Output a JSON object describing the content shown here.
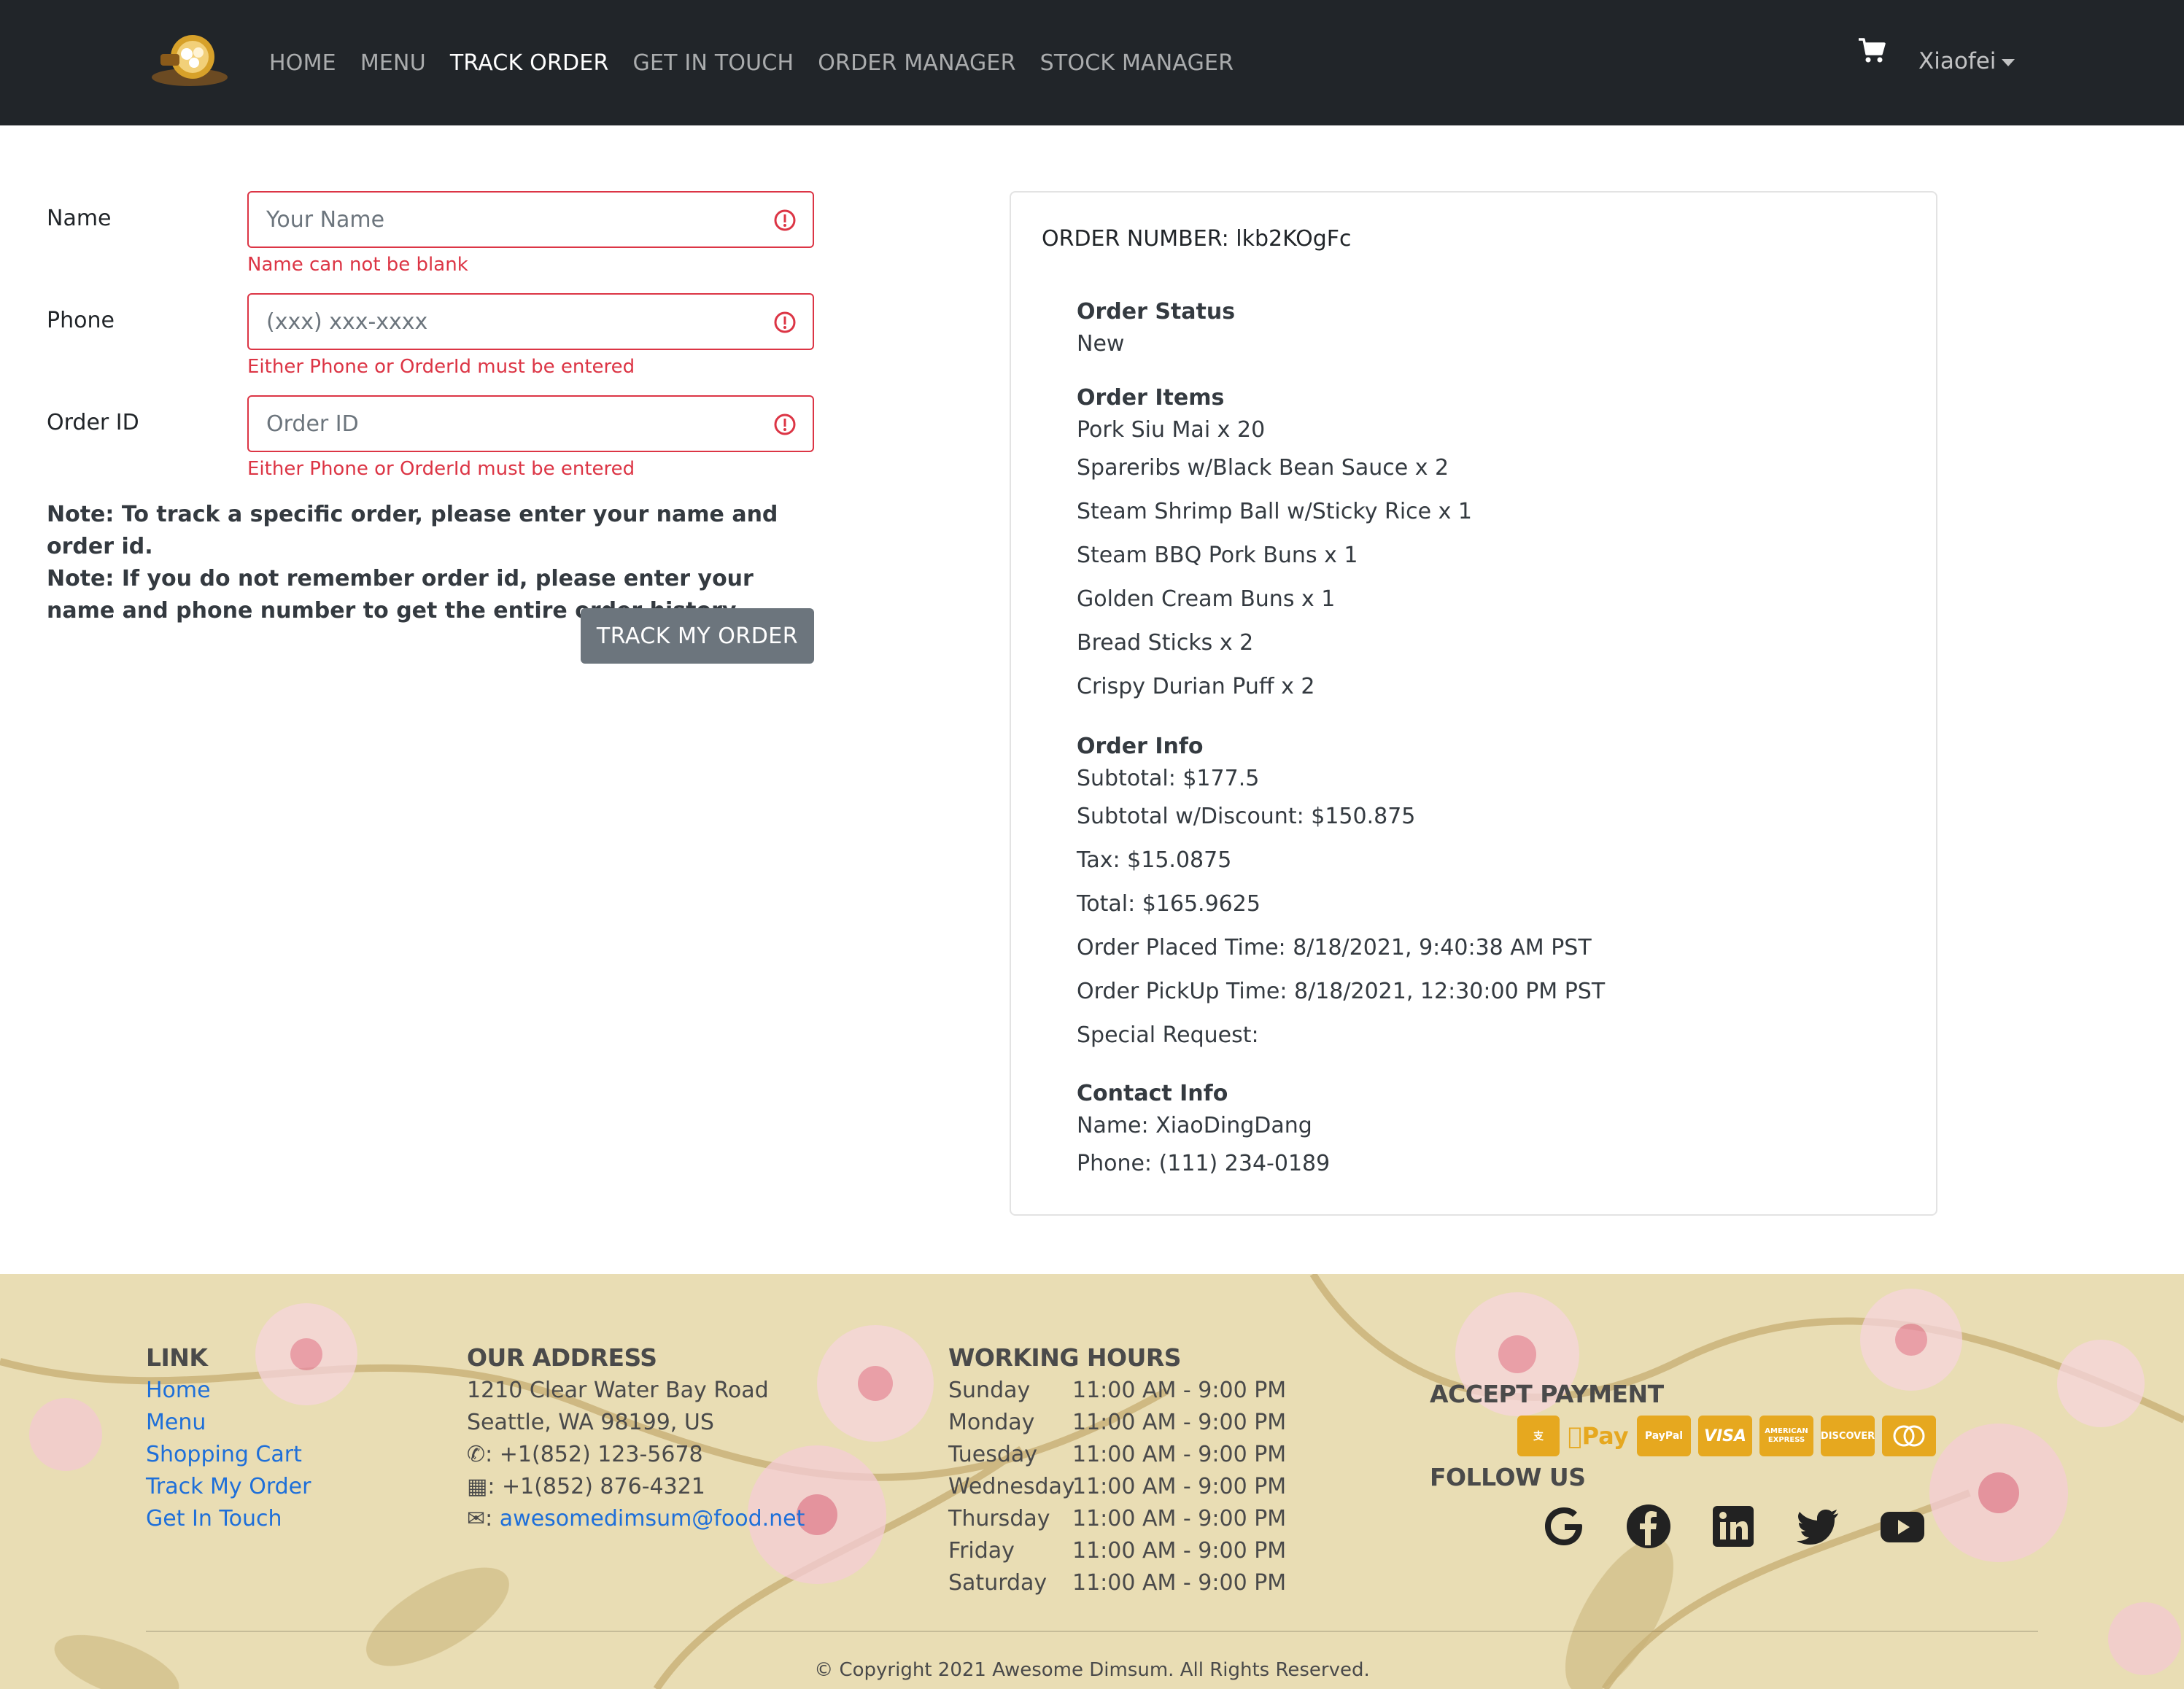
{
  "nav": {
    "links": [
      "HOME",
      "MENU",
      "TRACK ORDER",
      "GET IN TOUCH",
      "ORDER MANAGER",
      "STOCK MANAGER"
    ],
    "active_index": 2,
    "user": "Xiaofei"
  },
  "form": {
    "name": {
      "label": "Name",
      "placeholder": "Your Name",
      "error": "Name can not be blank"
    },
    "phone": {
      "label": "Phone",
      "placeholder": "(xxx) xxx-xxxx",
      "error": "Either Phone or OrderId must be entered"
    },
    "order_id": {
      "label": "Order ID",
      "placeholder": "Order ID",
      "error": "Either Phone or OrderId must be entered"
    },
    "note1": "Note: To track a specific order, please enter your name and order id.",
    "note2": "Note: If you do not remember order id, please enter your name and phone number to get the entire order history.",
    "button": "TRACK MY ORDER"
  },
  "order": {
    "number": "ORDER NUMBER: lkb2KOgFc",
    "status_title": "Order Status",
    "status": "New",
    "items_title": "Order Items",
    "items": [
      "Pork Siu Mai x 20",
      "Spareribs w/Black Bean Sauce x 2",
      "Steam Shrimp Ball w/Sticky Rice x 1",
      "Steam BBQ Pork Buns x 1",
      "Golden Cream Buns x 1",
      "Bread Sticks x 2",
      "Crispy Durian Puff x 2"
    ],
    "info_title": "Order Info",
    "info": [
      "Subtotal: $177.5",
      "Subtotal w/Discount: $150.875",
      "Tax: $15.0875",
      "Total: $165.9625",
      "Order Placed Time: 8/18/2021, 9:40:38 AM PST",
      "Order PickUp Time: 8/18/2021, 12:30:00 PM PST",
      "Special Request:"
    ],
    "contact_title": "Contact Info",
    "contact": [
      "Name: XiaoDingDang",
      "Phone: (111) 234-0189"
    ]
  },
  "footer": {
    "link_title": "LINK",
    "links": [
      "Home",
      "Menu",
      "Shopping Cart",
      "Track My Order",
      "Get In Touch"
    ],
    "address_title": "OUR ADDRESS",
    "address1": "1210 Clear Water Bay Road",
    "address2": "Seattle, WA 98199, US",
    "phone": ": +1(852) 123-5678",
    "fax": ": +1(852) 876-4321",
    "email": "awesomedimsum@food.net",
    "hours_title": "WORKING HOURS",
    "hours": [
      {
        "day": "Sunday",
        "time": "11:00 AM - 9:00 PM"
      },
      {
        "day": "Monday",
        "time": "11:00 AM - 9:00 PM"
      },
      {
        "day": "Tuesday",
        "time": "11:00 AM - 9:00 PM"
      },
      {
        "day": "Wednesday",
        "time": "11:00 AM - 9:00 PM"
      },
      {
        "day": "Thursday",
        "time": "11:00 AM - 9:00 PM"
      },
      {
        "day": "Friday",
        "time": "11:00 AM - 9:00 PM"
      },
      {
        "day": "Saturday",
        "time": "11:00 AM - 9:00 PM"
      }
    ],
    "payment_title": "ACCEPT PAYMENT",
    "payment_methods": [
      "alipay",
      "Pay",
      "PayPal",
      "VISA",
      "AMERICAN EXPRESS",
      "DISCOVER",
      "mastercard"
    ],
    "follow_title": "FOLLOW US",
    "social": [
      "google-icon",
      "facebook-icon",
      "linkedin-icon",
      "twitter-icon",
      "youtube-icon"
    ],
    "copyright": "© Copyright 2021 Awesome Dimsum. All Rights Reserved.",
    "accent": "#e6a81f",
    "background": "#e9ddb4"
  }
}
